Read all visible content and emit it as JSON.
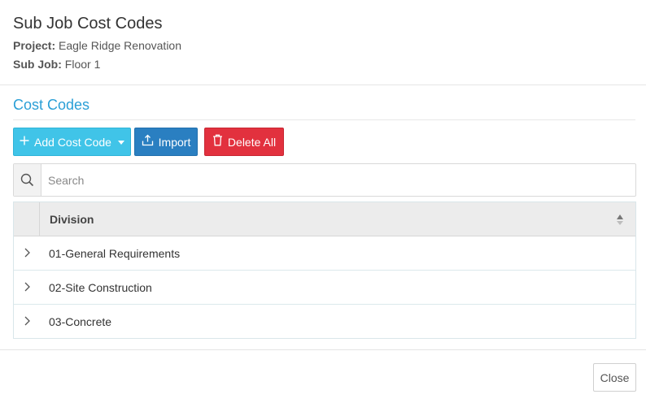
{
  "header": {
    "title": "Sub Job Cost Codes",
    "project_label": "Project:",
    "project_value": "Eagle Ridge Renovation",
    "subjob_label": "Sub Job:",
    "subjob_value": "Floor 1"
  },
  "section": {
    "title": "Cost Codes"
  },
  "toolbar": {
    "add_label": "Add Cost Code",
    "import_label": "Import",
    "delete_all_label": "Delete All"
  },
  "search": {
    "placeholder": "Search",
    "value": ""
  },
  "grid": {
    "column_division": "Division",
    "rows": [
      {
        "label": "01-General Requirements"
      },
      {
        "label": "02-Site Construction"
      },
      {
        "label": "03-Concrete"
      }
    ]
  },
  "footer": {
    "close_label": "Close"
  },
  "colors": {
    "accent": "#2a9fd6",
    "add_button": "#40c4e8",
    "import_button": "#2a7fc1",
    "delete_button": "#e2313e"
  },
  "icons": {
    "add": "plus-icon",
    "import": "upload-icon",
    "delete": "trash-icon",
    "search": "search-icon",
    "sort": "sort-icon",
    "row_expand": "chevron-right-icon"
  }
}
